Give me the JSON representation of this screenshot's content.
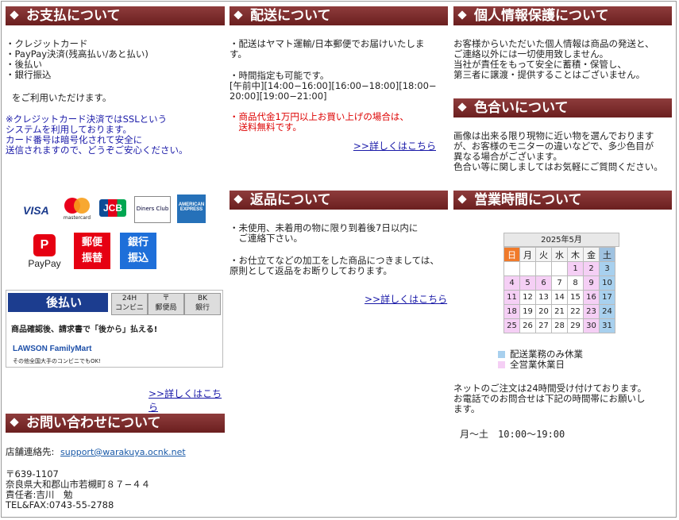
{
  "payment": {
    "title": "お支払について",
    "methods": [
      "・クレジットカード",
      "・PayPay決済(残高払い/あと払い)",
      "・後払い",
      "・銀行振込"
    ],
    "available": "をご利用いただけます。",
    "ssl_note": [
      "※クレジットカード決済ではSSLという",
      "システムを利用しております。",
      "カード番号は暗号化されて安全に",
      "送信されますので、どうぞご安心ください。"
    ],
    "logos": {
      "visa": "VISA",
      "mastercard": "mastercard",
      "jcb": "JCB",
      "diners": "Diners Club",
      "amex": "AMERICAN EXPRESS",
      "paypay": "PayPay",
      "yubin1": "郵便",
      "yubin2": "振替",
      "ginko1": "銀行",
      "ginko2": "振込"
    },
    "atobarai": {
      "brand": "後払い",
      "tab1": "24H",
      "tab1_sub": "コンビニ",
      "tab2": "〒",
      "tab2_sub": "郵便局",
      "tab3": "BK",
      "tab3_sub": "銀行",
      "line": "商品確認後、請求書で「後から」払える!",
      "stores": "LAWSON  FamilyMart",
      "foot": "その他全国大手のコンビニでもOK!"
    },
    "more": ">>詳しくはこちら"
  },
  "contact": {
    "title": "お問い合わせについて",
    "label": "店舗連絡先:",
    "email": "support@warakuya.ocnk.net",
    "address": [
      "〒639-1107",
      "奈良県大和郡山市若槻町８７−４４",
      "責任者:吉川　勉",
      "TEL&FAX:0743-55-2788"
    ]
  },
  "shipping": {
    "title": "配送について",
    "lines": [
      "・配送はヤマト運輸/日本郵便でお届けいたしま",
      "す。"
    ],
    "time": [
      "・時間指定も可能です。",
      "[午前中][14:00−16:00][16:00−18:00][18:00−",
      "20:00][19:00−21:00]"
    ],
    "free": [
      "・商品代金1万円以上お買い上げの場合は、",
      "　送料無料です。"
    ],
    "more": ">>詳しくはこちら"
  },
  "returns": {
    "title": "返品について",
    "lines": [
      "・未使用、未着用の物に限り到着後7日以内に",
      "　ご連絡下さい。"
    ],
    "lines2": [
      "・お仕立てなどの加工をした商品につきましては、",
      "原則として返品をお断りしております。"
    ],
    "more": ">>詳しくはこちら"
  },
  "privacy": {
    "title": "個人情報保護について",
    "lines": [
      "お客様からいただいた個人情報は商品の発送と、",
      "ご連絡以外には一切使用致しません。",
      "当社が責任をもって安全に蓄積・保管し、",
      "第三者に譲渡・提供することはございません。"
    ]
  },
  "color": {
    "title": "色合いについて",
    "lines": [
      "画像は出来る限り現物に近い物を選んでおります",
      "が、お客様のモニターの違いなどで、多少色目が",
      "異なる場合がございます。",
      "色合い等に関しましてはお気軽にご質問ください。"
    ]
  },
  "hours": {
    "title": "営業時間について",
    "calendar": {
      "month": "2025年5月",
      "weekdays": [
        "日",
        "月",
        "火",
        "水",
        "木",
        "金",
        "土"
      ],
      "weeks": [
        [
          "",
          "",
          "",
          "",
          "1",
          "2",
          "3"
        ],
        [
          "4",
          "5",
          "6",
          "7",
          "8",
          "9",
          "10"
        ],
        [
          "11",
          "12",
          "13",
          "14",
          "15",
          "16",
          "17"
        ],
        [
          "18",
          "19",
          "20",
          "21",
          "22",
          "23",
          "24"
        ],
        [
          "25",
          "26",
          "27",
          "28",
          "29",
          "30",
          "31"
        ]
      ],
      "colors": {
        "shipping_closed": "#a8d0ee",
        "all_closed": "#f5cff5",
        "sunday_head": "#f07a2a",
        "saturday_head": "#9fc2e0"
      }
    },
    "legend": [
      "配送業務のみ休業",
      "全営業休業日"
    ],
    "net": [
      "ネットのご注文は24時間受け付けております。",
      "お電話でのお問合せは下記の時間帯にお願いし",
      "ます。"
    ],
    "schedule": "月〜土　10:00〜19:00"
  }
}
